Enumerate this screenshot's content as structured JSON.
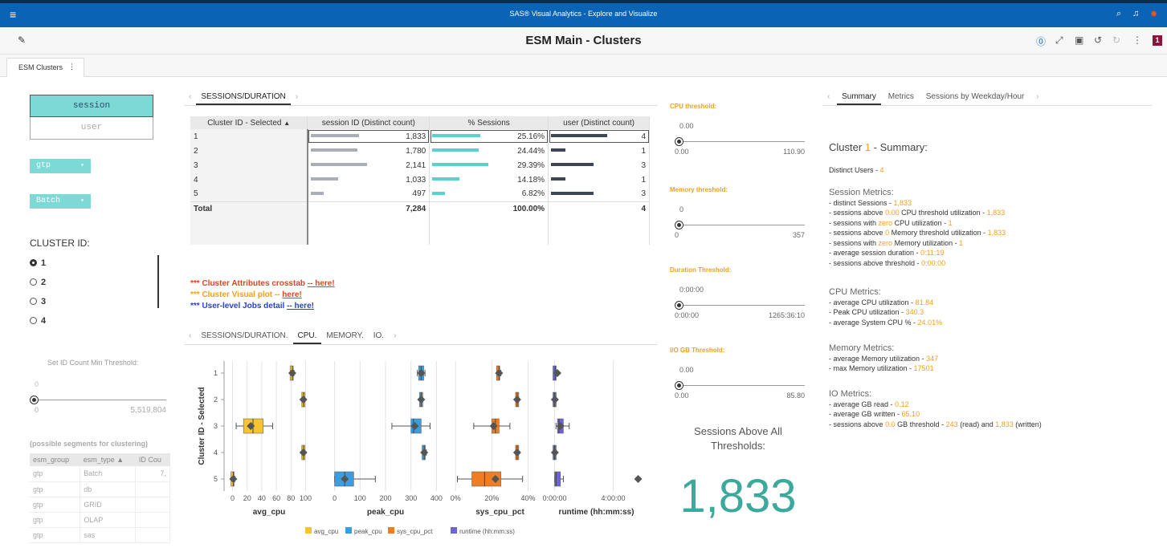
{
  "app": {
    "title": "SAS® Visual Analytics - Explore and Visualize",
    "report_title": "ESM Main - Clusters",
    "badge": "1",
    "page_tab": "ESM Clusters"
  },
  "left": {
    "button_list": [
      "session",
      "user"
    ],
    "dropdowns": [
      "gtp",
      "Batch"
    ],
    "cluster_label": "CLUSTER ID:",
    "cluster_options": [
      "1",
      "2",
      "3",
      "4"
    ],
    "selected_cluster": "1",
    "set_id_label": "Set ID Count Min Threshold:",
    "set_id_slider": {
      "current": "0",
      "min": "0",
      "max": "5,519,804"
    },
    "segments_label": "(possible segments for clustering)",
    "segments_headers": [
      "esm_group",
      "esm_type ▲",
      "ID Cou"
    ],
    "segments_rows": [
      [
        "gtp",
        "Batch",
        "7,"
      ],
      [
        "gtp",
        "db",
        ""
      ],
      [
        "gtp",
        "GRID",
        ""
      ],
      [
        "gtp",
        "OLAP",
        ""
      ],
      [
        "gtp",
        "sas",
        ""
      ]
    ]
  },
  "crosstab": {
    "tab": "SESSIONS/DURATION",
    "headers": [
      "Cluster ID - Selected",
      "session ID (Distinct count)",
      "% Sessions",
      "user (Distinct count)"
    ],
    "rows": [
      {
        "id": "1",
        "sessions": "1,833",
        "pct": "25.16%",
        "users": "4",
        "sv": 1833,
        "pv": 25.16,
        "uv": 4
      },
      {
        "id": "2",
        "sessions": "1,780",
        "pct": "24.44%",
        "users": "1",
        "sv": 1780,
        "pv": 24.44,
        "uv": 1
      },
      {
        "id": "3",
        "sessions": "2,141",
        "pct": "29.39%",
        "users": "3",
        "sv": 2141,
        "pv": 29.39,
        "uv": 3
      },
      {
        "id": "4",
        "sessions": "1,033",
        "pct": "14.18%",
        "users": "1",
        "sv": 1033,
        "pv": 14.18,
        "uv": 1
      },
      {
        "id": "5",
        "sessions": "497",
        "pct": "6.82%",
        "users": "3",
        "sv": 497,
        "pv": 6.82,
        "uv": 3
      }
    ],
    "total": {
      "label": "Total",
      "sessions": "7,284",
      "pct": "100.00%",
      "users": "4"
    }
  },
  "links": {
    "l1_prefix": "*** Cluster Attributes crosstab ",
    "l1_link": "-- here!",
    "l2_prefix": "*** Cluster Visual plot -- ",
    "l2_link": "here!",
    "l3_prefix": "*** User-level Jobs detail ",
    "l3_link": "-- here!"
  },
  "plot_tabs": [
    "SESSIONS/DURATION.",
    "CPU.",
    "MEMORY.",
    "IO."
  ],
  "plot_active_tab": "CPU.",
  "chart_data": {
    "type": "boxplot",
    "ylabel": "Cluster ID - Selected",
    "categories": [
      "1",
      "2",
      "3",
      "4",
      "5"
    ],
    "panels": [
      {
        "name": "avg_cpu",
        "xlabel": "avg_cpu",
        "color": "#f5c430",
        "xlim": [
          -5,
          105
        ],
        "ticks": [
          0,
          20,
          40,
          60,
          80,
          100
        ],
        "boxes": [
          {
            "min": 80,
            "q1": 81,
            "median": 82,
            "q3": 83,
            "max": 84,
            "mean": 81.84
          },
          {
            "min": 97,
            "q1": 97,
            "median": 97,
            "q3": 97,
            "max": 97,
            "mean": 97
          },
          {
            "min": 5,
            "q1": 15,
            "median": 28,
            "q3": 42,
            "max": 55,
            "mean": 25
          },
          {
            "min": 97,
            "q1": 97,
            "median": 97,
            "q3": 97,
            "max": 97,
            "mean": 97
          },
          {
            "min": 0,
            "q1": 0,
            "median": 1,
            "q3": 2,
            "max": 3,
            "mean": 1
          }
        ]
      },
      {
        "name": "peak_cpu",
        "xlabel": "peak_cpu",
        "color": "#3b9de0",
        "xlim": [
          -5,
          405
        ],
        "ticks": [
          0,
          100,
          200,
          300,
          400
        ],
        "boxes": [
          {
            "min": 325,
            "q1": 330,
            "median": 340,
            "q3": 350,
            "max": 355,
            "mean": 340.3
          },
          {
            "min": 340,
            "q1": 340,
            "median": 340,
            "q3": 340,
            "max": 340,
            "mean": 340
          },
          {
            "min": 225,
            "q1": 300,
            "median": 310,
            "q3": 340,
            "max": 375,
            "mean": 315
          },
          {
            "min": 350,
            "q1": 350,
            "median": 352,
            "q3": 355,
            "max": 360,
            "mean": 352
          },
          {
            "min": 0,
            "q1": 0,
            "median": 40,
            "q3": 75,
            "max": 160,
            "mean": 40
          }
        ]
      },
      {
        "name": "sys_cpu_pct",
        "xlabel": "sys_cpu_pct",
        "color": "#f07d22",
        "xlim": [
          -1,
          50
        ],
        "ticks": [
          0,
          20,
          40
        ],
        "tick_labels": [
          "0%",
          "20%",
          "40%"
        ],
        "boxes": [
          {
            "min": 23,
            "q1": 23.5,
            "median": 24,
            "q3": 24.5,
            "max": 25,
            "mean": 24.01
          },
          {
            "min": 34,
            "q1": 34,
            "median": 34,
            "q3": 34,
            "max": 34,
            "mean": 34
          },
          {
            "min": 10,
            "q1": 20,
            "median": 22,
            "q3": 24,
            "max": 30,
            "mean": 21
          },
          {
            "min": 34,
            "q1": 34,
            "median": 34,
            "q3": 34,
            "max": 34,
            "mean": 34
          },
          {
            "min": 1,
            "q1": 9,
            "median": 16,
            "q3": 25,
            "max": 37,
            "mean": 22
          }
        ]
      },
      {
        "name": "runtime",
        "xlabel": "runtime (hh:mm:ss)",
        "color": "#6b63d6",
        "xlim": [
          -0.3,
          6
        ],
        "ticks": [
          0,
          4
        ],
        "tick_labels": [
          "0:00:00",
          "4:00:00"
        ],
        "boxes": [
          {
            "min": 0,
            "q1": 0,
            "median": 0.05,
            "q3": 0.1,
            "max": 0.15,
            "mean": 0.19
          },
          {
            "min": 0,
            "q1": 0,
            "median": 0,
            "q3": 0.05,
            "max": 0.05,
            "mean": 0.02
          },
          {
            "min": 0.1,
            "q1": 0.2,
            "median": 0.3,
            "q3": 0.6,
            "max": 1.0,
            "mean": 0.4
          },
          {
            "min": 0,
            "q1": 0,
            "median": 0,
            "q3": 0.05,
            "max": 0.05,
            "mean": 0.02
          },
          {
            "min": 0,
            "q1": 0,
            "median": 0.1,
            "q3": 0.4,
            "max": 0.6,
            "mean": 5.7
          }
        ]
      }
    ],
    "legend": [
      "avg_cpu",
      "peak_cpu",
      "sys_cpu_pct",
      "runtime (hh:mm:ss)"
    ]
  },
  "thresholds": [
    {
      "label": "CPU threshold:",
      "current": "0.00",
      "min": "0.00",
      "max": "110.90"
    },
    {
      "label": "Memory threshold:",
      "current": "0",
      "min": "0",
      "max": "357"
    },
    {
      "label": "Duration Threshold:",
      "current": "0:00:00",
      "min": "0:00:00",
      "max": "1265:36:10"
    },
    {
      "label": "I/O GB Threshold:",
      "current": "0.00",
      "min": "0.00",
      "max": "85.80"
    }
  ],
  "sessions_above": {
    "title": "Sessions Above All Thresholds:",
    "value": "1,833"
  },
  "summary": {
    "tabs": [
      "Summary",
      "Metrics",
      "Sessions by Weekday/Hour"
    ],
    "title_prefix": "Cluster",
    "cluster": "1",
    "title_suffix": "- Summary:",
    "distinct_users_label": "Distinct Users -",
    "distinct_users": "4",
    "session_metrics_title": "Session Metrics:",
    "cpu_metrics_title": "CPU Metrics:",
    "memory_metrics_title": "Memory Metrics:",
    "io_metrics_title": "IO Metrics:",
    "s1a": "- distinct Sessions -",
    "s1v": "1,833",
    "s2a": "- sessions above",
    "s2v": "0.00",
    "s2b": "CPU threshold utilization -",
    "s2w": "1,833",
    "s3a": "- sessions with",
    "s3v": "zero",
    "s3b": "CPU utilization -",
    "s3w": "1",
    "s4a": "- sessions above",
    "s4v": "0",
    "s4b": "Memory threshold utilization -",
    "s4w": "1,833",
    "s5a": "- sessions with",
    "s5v": "zero",
    "s5b": "Memory utilization -",
    "s5w": "1",
    "s6a": "- average session duration -",
    "s6v": "0:11:19",
    "s7a": "- sessions above threshold -",
    "s7v": "0:00:00",
    "c1a": "- average CPU utilization -",
    "c1v": "81.84",
    "c2a": "- Peak CPU utilization -",
    "c2v": "340.3",
    "c3a": "- average System CPU % -",
    "c3v": "24.01%",
    "m1a": "- average Memory utilization -",
    "m1v": "347",
    "m2a": "- max Memory utilization -",
    "m2v": "17501",
    "i1a": "- average GB read -",
    "i1v": "0.12",
    "i2a": "- average GB written -",
    "i2v": "65.10",
    "i3a": "- sessions above",
    "i3v": "0.0",
    "i3b": "GB threshold -",
    "i3w": "243",
    "i3c": "(read) and",
    "i3x": "1,833",
    "i3d": "(written)"
  }
}
